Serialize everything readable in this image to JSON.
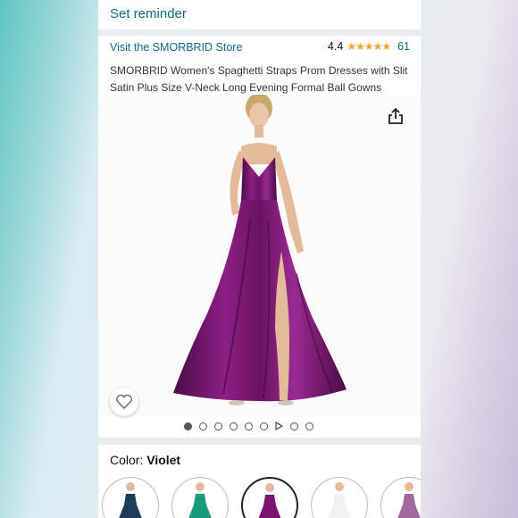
{
  "reminder": {
    "label": "Set reminder"
  },
  "store": {
    "link": "Visit the SMORBRID Store"
  },
  "rating": {
    "value": "4.4",
    "stars": "★★★★★",
    "count": "61"
  },
  "product": {
    "title": "SMORBRID Women's Spaghetti Straps Prom Dresses with Slit Satin Plus Size V-Neck Long Evening Formal Ball Gowns"
  },
  "gallery": {
    "image_count": 8,
    "current_index": 1,
    "has_video": true
  },
  "color": {
    "label": "Color: ",
    "value": "Violet"
  },
  "swatches": [
    {
      "name": "navy",
      "color": "#1f3c5a",
      "selected": false
    },
    {
      "name": "green",
      "color": "#1a9a7a",
      "selected": false
    },
    {
      "name": "violet",
      "color": "#7a1670",
      "selected": true
    },
    {
      "name": "white",
      "color": "#f2f2f2",
      "selected": false
    },
    {
      "name": "lilac",
      "color": "#a06a9a",
      "selected": false
    }
  ],
  "colors": {
    "link": "#0f6b82",
    "star": "#f5a623",
    "dress": "#7a1670"
  }
}
